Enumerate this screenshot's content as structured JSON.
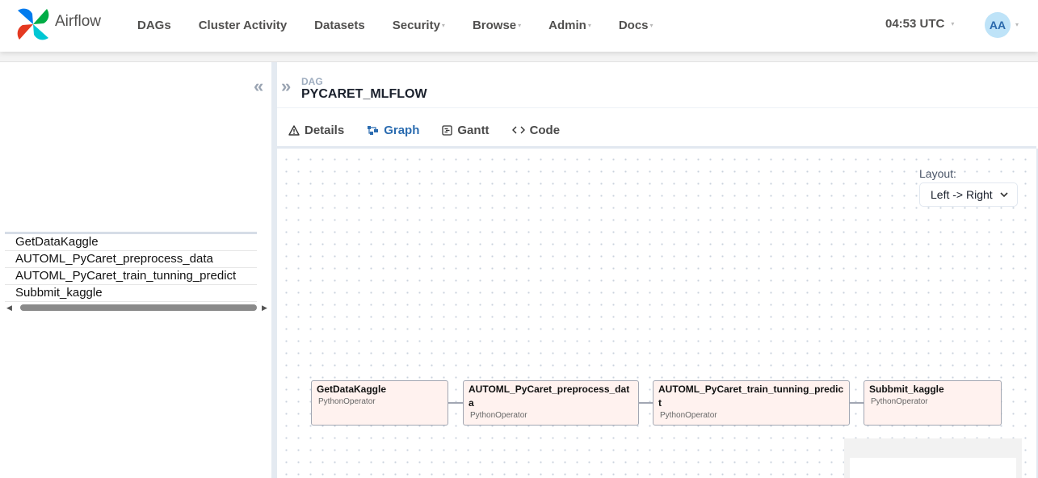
{
  "app": {
    "name": "Airflow"
  },
  "nav": {
    "items": [
      {
        "label": "DAGs",
        "dropdown": false
      },
      {
        "label": "Cluster Activity",
        "dropdown": false
      },
      {
        "label": "Datasets",
        "dropdown": false
      },
      {
        "label": "Security",
        "dropdown": true
      },
      {
        "label": "Browse",
        "dropdown": true
      },
      {
        "label": "Admin",
        "dropdown": true
      },
      {
        "label": "Docs",
        "dropdown": true
      }
    ],
    "clock": "04:53 UTC",
    "avatar_initials": "AA"
  },
  "grid": {
    "tasks": [
      "GetDataKaggle",
      "AUTOML_PyCaret_preprocess_data",
      "AUTOML_PyCaret_train_tunning_predict",
      "Subbmit_kaggle"
    ]
  },
  "details": {
    "dag_label": "DAG",
    "dag_id": "PYCARET_MLFLOW",
    "tabs": [
      {
        "label": "Details",
        "icon": "warning-triangle-icon",
        "active": false
      },
      {
        "label": "Graph",
        "icon": "graph-icon",
        "active": true
      },
      {
        "label": "Gantt",
        "icon": "gantt-icon",
        "active": false
      },
      {
        "label": "Code",
        "icon": "code-icon",
        "active": false
      }
    ]
  },
  "graph": {
    "layout_label": "Layout:",
    "layout_value": "Left -> Right",
    "nodes": [
      {
        "name": "GetDataKaggle",
        "operator": "PythonOperator"
      },
      {
        "name": "AUTOML_PyCaret_preprocess_data",
        "operator": "PythonOperator"
      },
      {
        "name": "AUTOML_PyCaret_train_tunning_predict",
        "operator": "PythonOperator"
      },
      {
        "name": "Subbmit_kaggle",
        "operator": "PythonOperator"
      }
    ]
  },
  "colors": {
    "accent": "#2b6cb0",
    "node_fill": "#fff2ef",
    "node_border": "#a2a7b3"
  }
}
